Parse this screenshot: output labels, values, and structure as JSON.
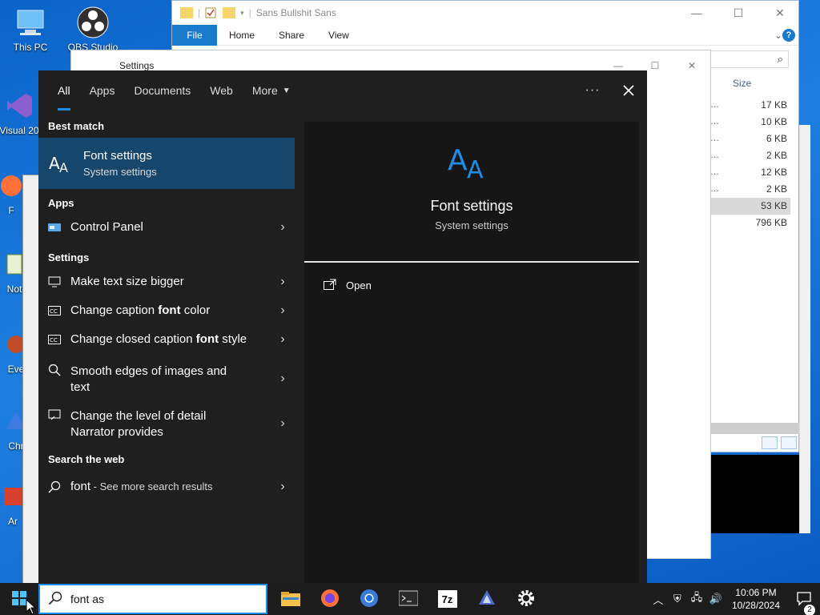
{
  "desktop": {
    "icons": [
      {
        "label": "This PC",
        "icon": "this-pc-icon"
      },
      {
        "label": "OBS Studio",
        "icon": "obs-icon"
      },
      {
        "label": "Visual 20",
        "icon": "visual-studio-icon"
      },
      {
        "label": "F",
        "icon": "firefox-icon"
      },
      {
        "label": "Not",
        "icon": "notepad-icon"
      },
      {
        "label": "Eve",
        "icon": "event-icon"
      },
      {
        "label": "Chr",
        "icon": "chrome-icon"
      },
      {
        "label": "Ar",
        "icon": "app-icon"
      }
    ]
  },
  "explorer": {
    "title": "Sans Bullshit Sans",
    "tabs": {
      "file": "File",
      "home": "Home",
      "share": "Share",
      "view": "View"
    },
    "help": "?",
    "column_size": "Size",
    "sizes": [
      "17 KB",
      "10 KB",
      "6 KB",
      "2 KB",
      "12 KB",
      "2 KB",
      "53 KB",
      "796 KB"
    ],
    "selected_index": 6
  },
  "settings_window": {
    "title": "Settings"
  },
  "search_panel": {
    "tabs": {
      "all": "All",
      "apps": "Apps",
      "documents": "Documents",
      "web": "Web",
      "more": "More"
    },
    "best_match_header": "Best match",
    "best_match": {
      "title": "Font settings",
      "subtitle": "System settings"
    },
    "apps_header": "Apps",
    "apps": [
      {
        "label": "Control Panel"
      }
    ],
    "settings_header": "Settings",
    "settings": {
      "make_text_bigger": "Make text size bigger",
      "caption_color": {
        "pre": "Change caption ",
        "bold": "font",
        "post": " color"
      },
      "caption_style": {
        "pre": "Change closed caption ",
        "bold": "font",
        "post": " style"
      },
      "smooth_edges": "Smooth edges of images and text",
      "narrator_detail": "Change the level of detail Narrator provides"
    },
    "web_header": "Search the web",
    "web": {
      "term": "font",
      "suffix": " - See more search results"
    },
    "preview": {
      "title": "Font settings",
      "subtitle": "System settings",
      "open_label": "Open"
    }
  },
  "taskbar": {
    "search_value": "font as",
    "apps": [
      "file-explorer-icon",
      "firefox-icon",
      "chrome-icon",
      "terminal-icon",
      "7zip-icon",
      "inkscape-icon",
      "settings-gear-icon"
    ],
    "app_7z_label": "7z",
    "clock": {
      "time": "10:06 PM",
      "date": "10/28/2024"
    },
    "notifications_count": "2"
  },
  "colors": {
    "accent": "#1a8be6",
    "selected_bg": "#17466d",
    "panel_bg": "#1f1f1f",
    "font_icon_blue": "#1f8de8"
  }
}
